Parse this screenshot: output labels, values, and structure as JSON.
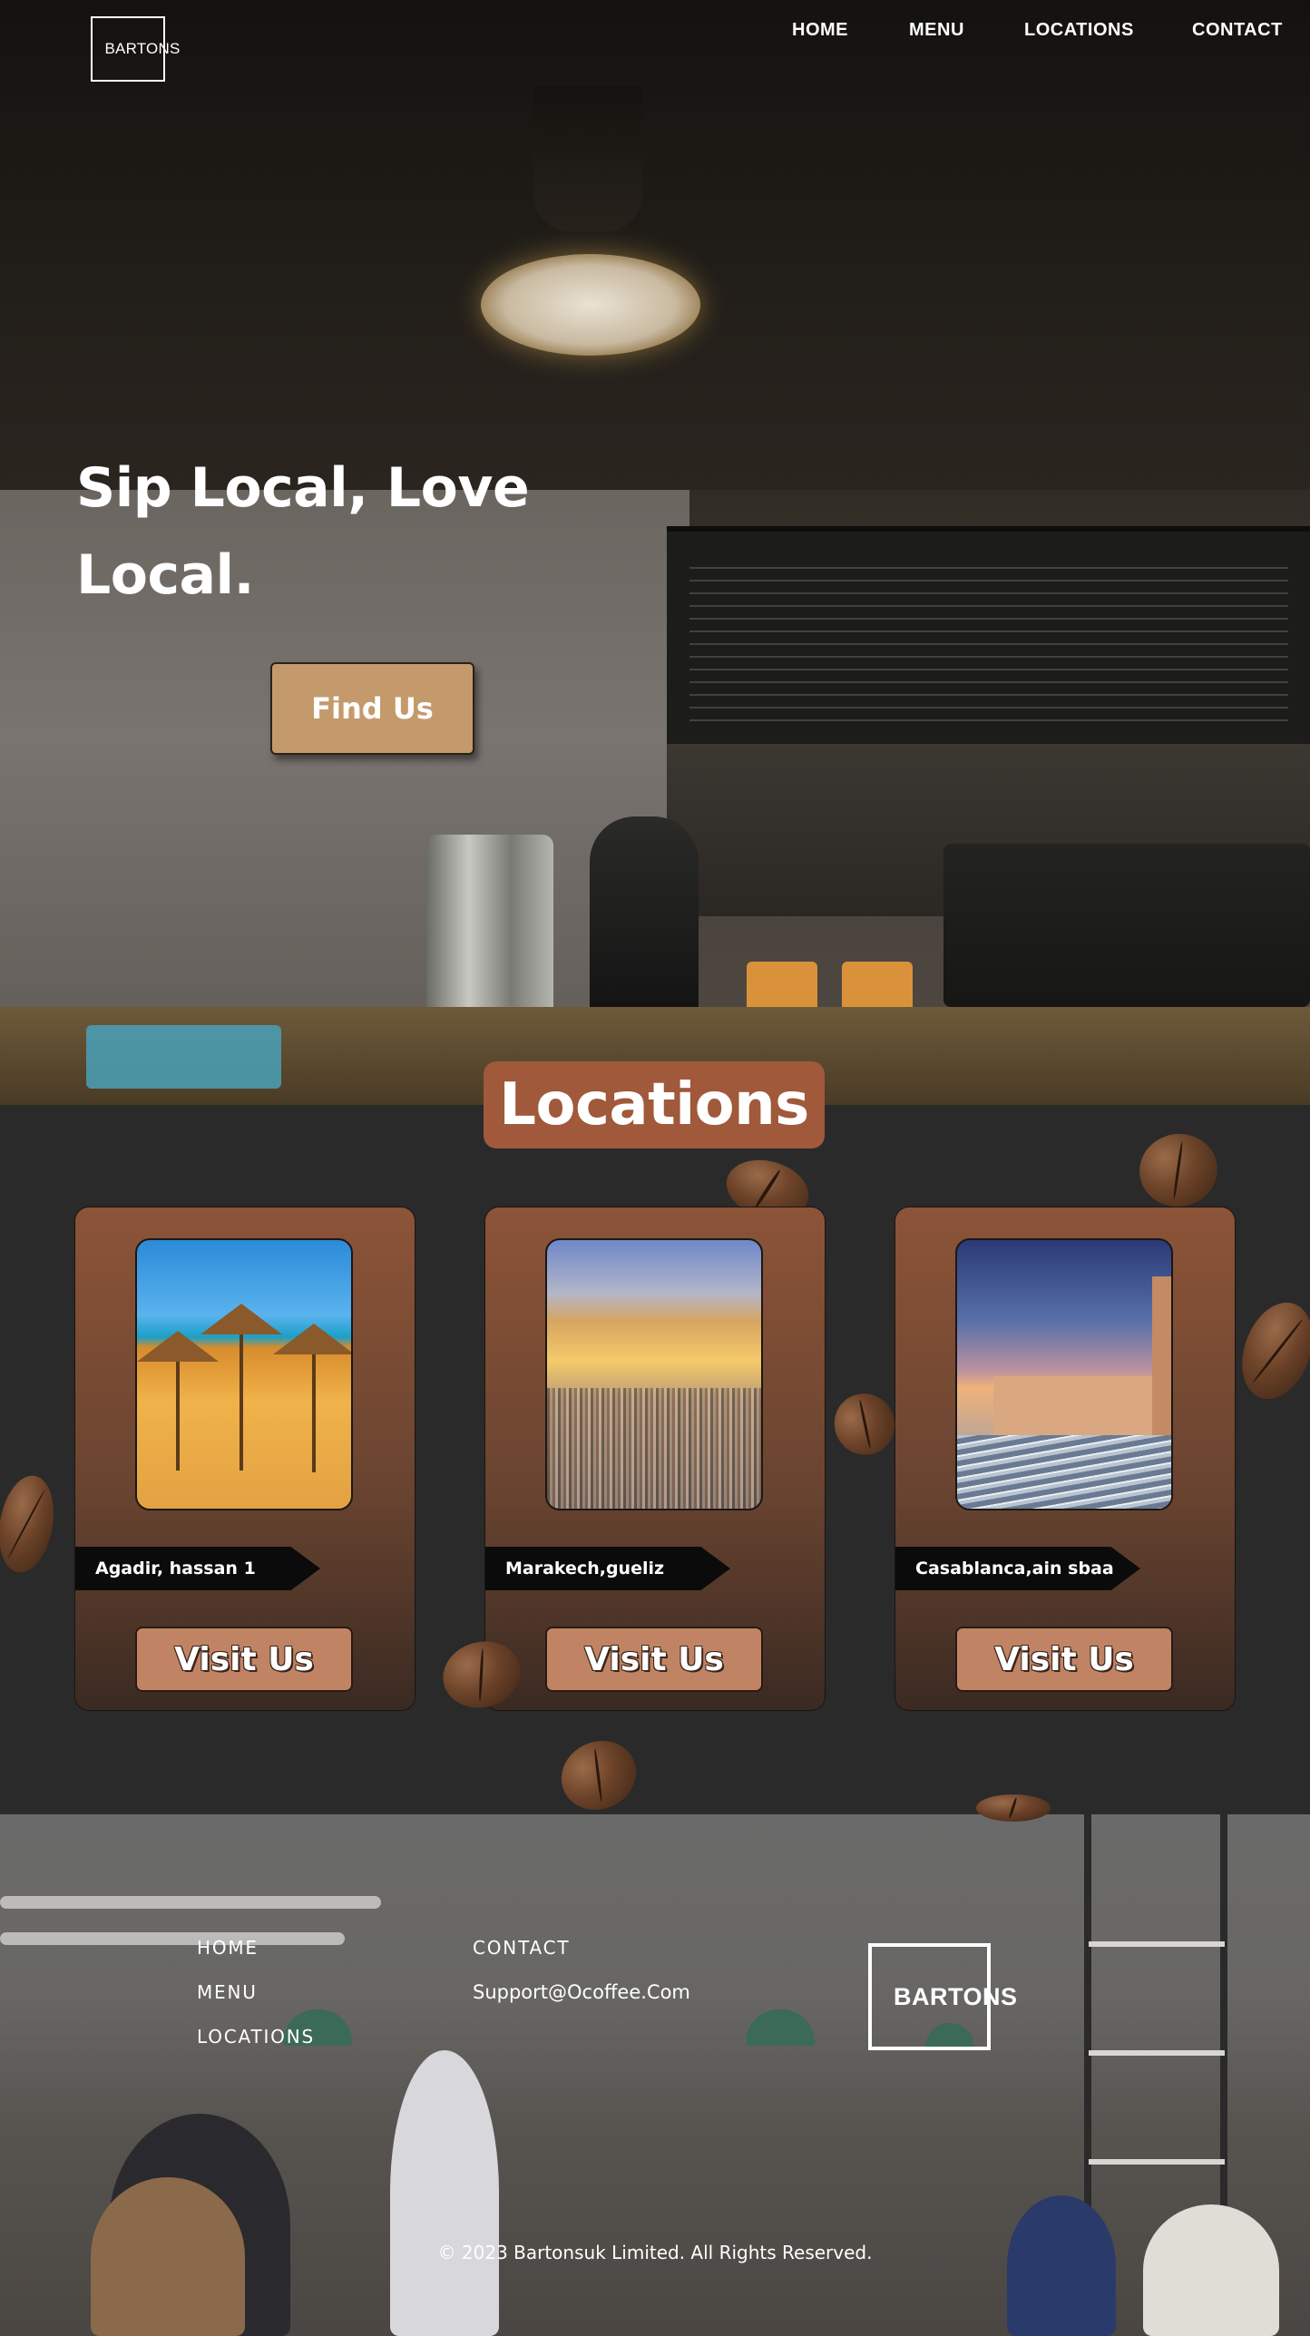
{
  "brand": {
    "logo_text": "BARTONS"
  },
  "nav": {
    "items": [
      {
        "label": "HOME"
      },
      {
        "label": "MENU"
      },
      {
        "label": "LOCATIONS"
      },
      {
        "label": "CONTACT"
      }
    ]
  },
  "hero": {
    "title": "Sip Local, Love Local.",
    "cta_label": "Find Us"
  },
  "locations": {
    "heading": "Locations",
    "cards": [
      {
        "name": "Agadir, hassan 1",
        "button_label": "Visit Us"
      },
      {
        "name": "Marakech,gueliz",
        "button_label": "Visit Us"
      },
      {
        "name": "Casablanca,ain sbaa",
        "button_label": "Visit Us"
      }
    ]
  },
  "footer": {
    "links": [
      {
        "label": "HOME"
      },
      {
        "label": "MENU"
      },
      {
        "label": "LOCATIONS"
      }
    ],
    "contact_label": "CONTACT",
    "email": "Support@Ocoffee.Com",
    "logo_text": "BARTONS",
    "copyright": "© 2023 Bartonsuk Limited. All Rights Reserved."
  },
  "colors": {
    "accent_brown": "#a0593a",
    "button_tan": "#c49a6c",
    "visit_button": "#c08465",
    "section_bg": "#2a2a2a"
  }
}
